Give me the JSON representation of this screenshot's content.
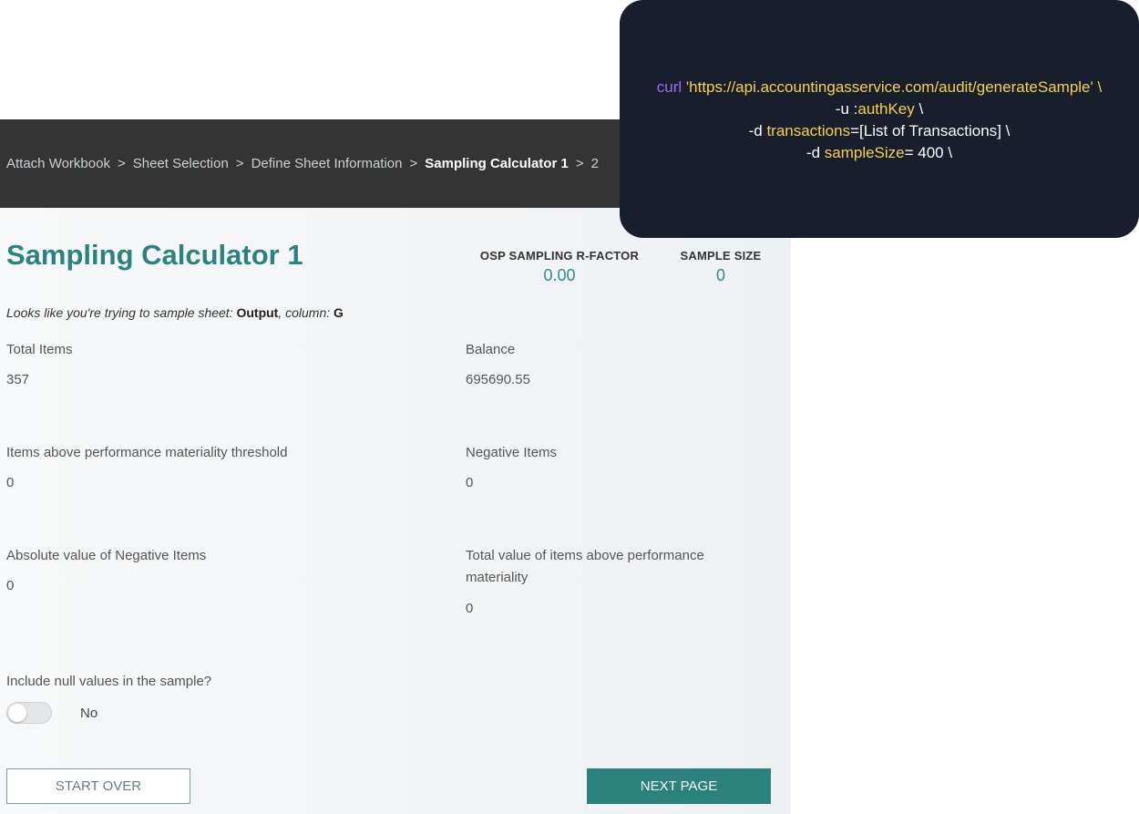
{
  "breadcrumb": {
    "items": [
      "Attach Workbook",
      "Sheet Selection",
      "Define Sheet Information",
      "Sampling Calculator 1",
      "2"
    ],
    "separator": ">"
  },
  "page": {
    "title": "Sampling Calculator 1",
    "r_factor_label": "OSP SAMPLING R-FACTOR",
    "r_factor_value": "0.00",
    "sample_size_label": "SAMPLE SIZE",
    "sample_size_value": "0",
    "sheet_note_prefix": "Looks like you're trying to sample sheet:",
    "sheet_name": "Output",
    "column_prefix": ", column:",
    "column_name": "G"
  },
  "fields": {
    "total_items": {
      "label": "Total Items",
      "value": "357"
    },
    "balance": {
      "label": "Balance",
      "value": "695690.55"
    },
    "above_threshold": {
      "label": "Items above performance materiality threshold",
      "value": "0"
    },
    "negative_items": {
      "label": "Negative Items",
      "value": "0"
    },
    "abs_negative": {
      "label": "Absolute value of Negative Items",
      "value": "0"
    },
    "total_above": {
      "label": "Total value of items above performance materiality",
      "value": "0"
    }
  },
  "null_toggle": {
    "question": "Include null values in the sample?",
    "state_label": "No",
    "on": false
  },
  "buttons": {
    "start_over": "START OVER",
    "next_page": "NEXT PAGE"
  },
  "code": {
    "cmd": "curl",
    "url": "'https://api.accountingasservice.com/audit/generateSample' \\",
    "line2_prefix": "-u :",
    "line2_param": "authKey",
    "line2_suffix": " \\",
    "line3_prefix": "-d ",
    "line3_param": "transactions",
    "line3_suffix": "=[List of Transactions] \\",
    "line4_prefix": "-d ",
    "line4_param": "sampleSize",
    "line4_suffix": "= 400 \\"
  },
  "colors": {
    "accent": "#2b8380",
    "header_bg": "#343434",
    "code_bg": "#191e2c",
    "code_keyword": "#9d6bff",
    "code_string": "#f2d24b"
  }
}
